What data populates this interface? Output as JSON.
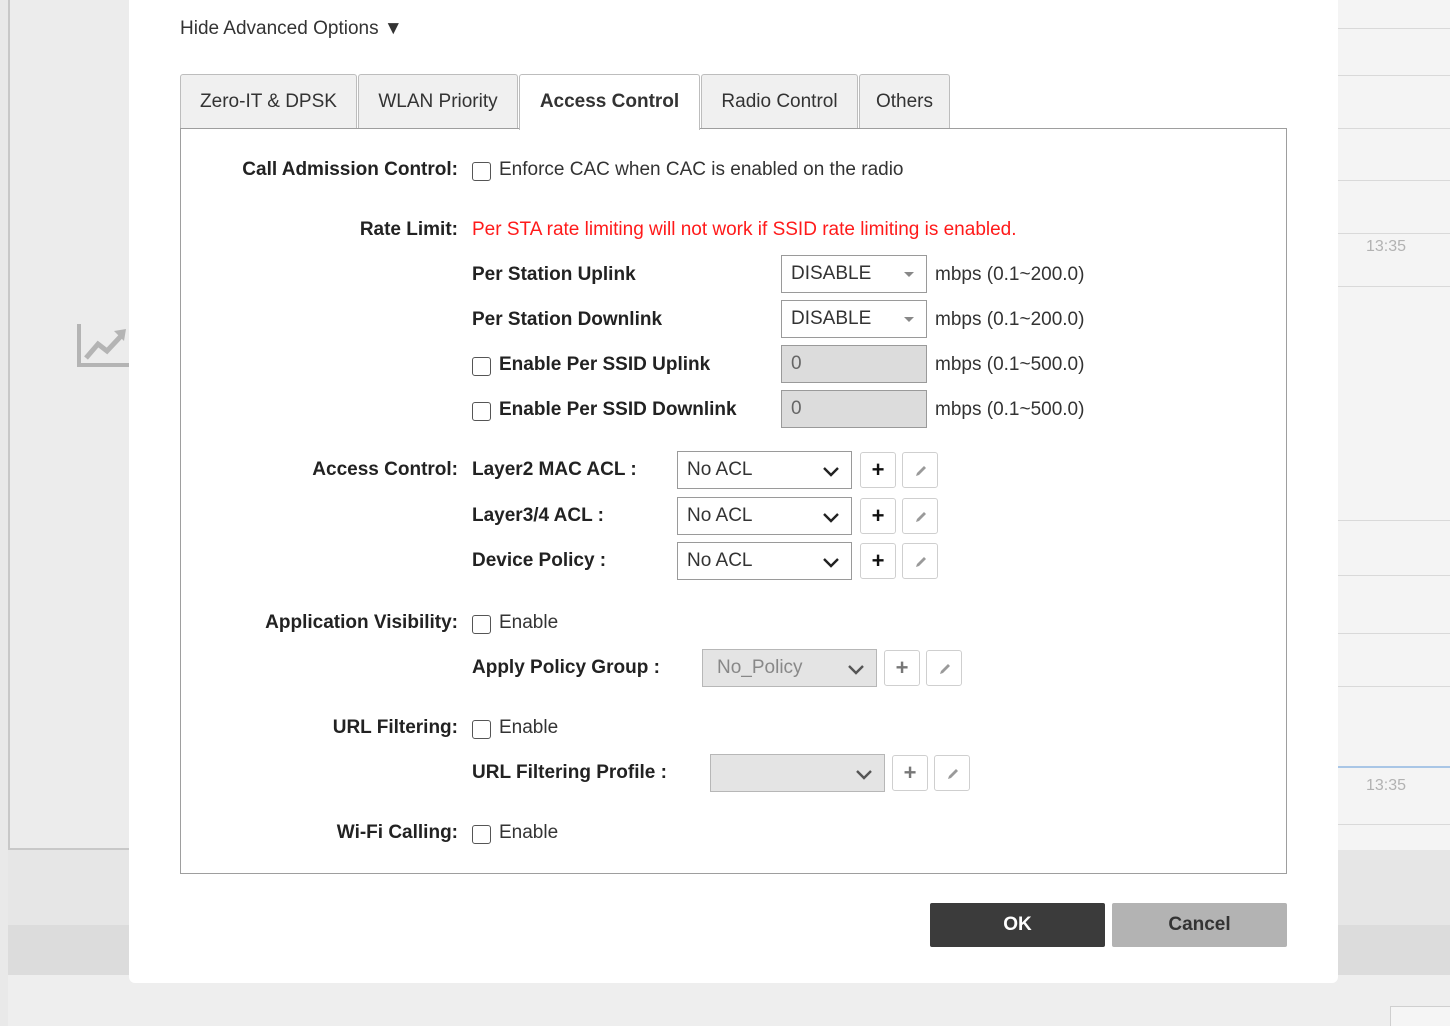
{
  "background": {
    "time_upper": "13:35",
    "time_lower": "13:35"
  },
  "modal": {
    "advanced_toggle": "Hide Advanced Options ▼",
    "tabs": [
      {
        "label": "Zero-IT & DPSK"
      },
      {
        "label": "WLAN Priority"
      },
      {
        "label": "Access Control",
        "active": true
      },
      {
        "label": "Radio Control"
      },
      {
        "label": "Others"
      }
    ],
    "cac": {
      "label": "Call Admission Control:",
      "checkbox_label": "Enforce CAC when CAC is enabled on the radio",
      "checked": false
    },
    "rate_limit": {
      "label": "Rate Limit:",
      "warning": "Per STA rate limiting will not work if SSID rate limiting is enabled.",
      "uplink_label": "Per Station Uplink",
      "uplink_value": "DISABLE",
      "uplink_unit": "mbps (0.1~200.0)",
      "downlink_label": "Per Station Downlink",
      "downlink_value": "DISABLE",
      "downlink_unit": "mbps (0.1~200.0)",
      "ssid_uplink_label": "Enable Per SSID Uplink",
      "ssid_uplink_value": "0",
      "ssid_uplink_unit": "mbps (0.1~500.0)",
      "ssid_downlink_label": "Enable Per SSID Downlink",
      "ssid_downlink_value": "0",
      "ssid_downlink_unit": "mbps (0.1~500.0)"
    },
    "access_control": {
      "label": "Access Control:",
      "l2_label": "Layer2 MAC ACL :",
      "l2_value": "No ACL",
      "l34_label": "Layer3/4 ACL :",
      "l34_value": "No ACL",
      "device_label": "Device Policy :",
      "device_value": "No ACL"
    },
    "app_visibility": {
      "label": "Application Visibility:",
      "enable_label": "Enable",
      "policy_label": "Apply Policy Group :",
      "policy_value": "No_Policy"
    },
    "url_filtering": {
      "label": "URL Filtering:",
      "enable_label": "Enable",
      "profile_label": "URL Filtering Profile :",
      "profile_value": ""
    },
    "wifi_calling": {
      "label": "Wi-Fi Calling:",
      "enable_label": "Enable"
    },
    "add_glyph": "+",
    "ok_label": "OK",
    "cancel_label": "Cancel"
  }
}
